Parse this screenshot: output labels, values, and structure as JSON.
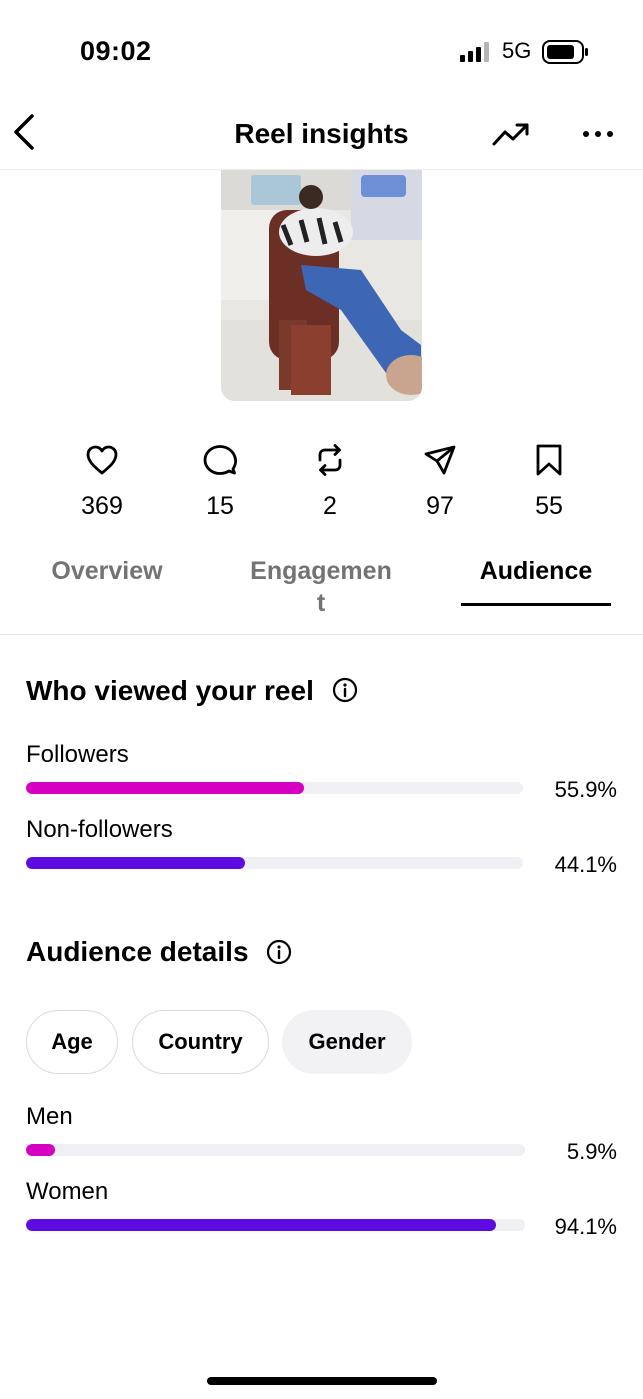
{
  "status_bar": {
    "time": "09:02",
    "network": "5G"
  },
  "nav": {
    "title": "Reel insights"
  },
  "stats": [
    {
      "icon": "heart-icon",
      "value": "369"
    },
    {
      "icon": "comment-icon",
      "value": "15"
    },
    {
      "icon": "repost-icon",
      "value": "2"
    },
    {
      "icon": "share-icon",
      "value": "97"
    },
    {
      "icon": "bookmark-icon",
      "value": "55"
    }
  ],
  "tabs": [
    {
      "label": "Overview",
      "active": false
    },
    {
      "label": "Engagemen\nt",
      "active": false
    },
    {
      "label": "Audience",
      "active": true
    }
  ],
  "viewers": {
    "title": "Who viewed your reel",
    "rows": [
      {
        "label": "Followers",
        "percent": "55.9%",
        "value": 55.9,
        "color": "#d600c2"
      },
      {
        "label": "Non-followers",
        "percent": "44.1%",
        "value": 44.1,
        "color": "#5d0be0"
      }
    ]
  },
  "audience": {
    "title": "Audience details",
    "chips": [
      {
        "label": "Age",
        "selected": false
      },
      {
        "label": "Country",
        "selected": false
      },
      {
        "label": "Gender",
        "selected": true
      }
    ],
    "rows": [
      {
        "label": "Men",
        "percent": "5.9%",
        "value": 5.9,
        "color": "#d600c2"
      },
      {
        "label": "Women",
        "percent": "94.1%",
        "value": 94.1,
        "color": "#5d0be0"
      }
    ]
  }
}
